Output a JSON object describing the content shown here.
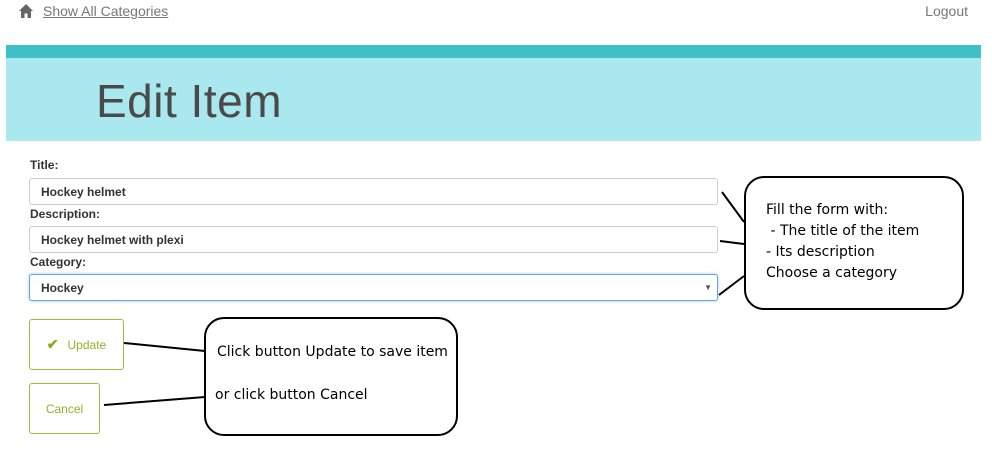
{
  "nav": {
    "home_label": "Show All Categories",
    "logout_label": "Logout",
    "home_icon": "home-icon"
  },
  "header": {
    "title": "Edit Item",
    "banner_color": "#a9e8ee",
    "strip_color": "#3fc0c6"
  },
  "form": {
    "title_label": "Title:",
    "title_value": "Hockey helmet",
    "description_label": "Description:",
    "description_value": "Hockey helmet with plexi",
    "category_label": "Category:",
    "category_value": "Hockey",
    "update_label": "Update",
    "cancel_label": "Cancel",
    "button_color": "#a7b836"
  },
  "annotations": {
    "form_help": [
      "Fill the form with:",
      " - The title of the item",
      "- Its description",
      "Choose a category"
    ],
    "buttons_help": [
      "Click button Update to save item",
      "or click button Cancel"
    ]
  }
}
